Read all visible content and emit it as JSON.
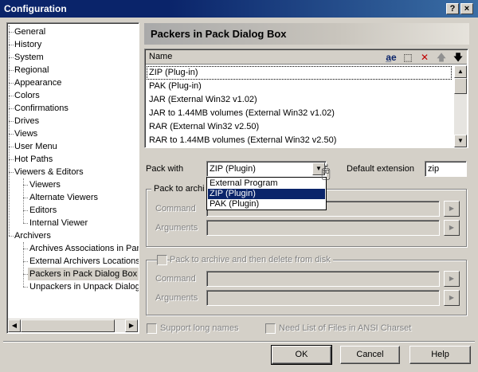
{
  "window": {
    "title": "Configuration",
    "help_glyph": "?",
    "close_glyph": "×"
  },
  "tree": {
    "items": [
      {
        "label": "General",
        "level": 0
      },
      {
        "label": "History",
        "level": 0
      },
      {
        "label": "System",
        "level": 0
      },
      {
        "label": "Regional",
        "level": 0
      },
      {
        "label": "Appearance",
        "level": 0
      },
      {
        "label": "Colors",
        "level": 0
      },
      {
        "label": "Confirmations",
        "level": 0
      },
      {
        "label": "Drives",
        "level": 0
      },
      {
        "label": "Views",
        "level": 0
      },
      {
        "label": "User Menu",
        "level": 0
      },
      {
        "label": "Hot Paths",
        "level": 0
      },
      {
        "label": "Viewers & Editors",
        "level": 0
      },
      {
        "label": "Viewers",
        "level": 1
      },
      {
        "label": "Alternate Viewers",
        "level": 1
      },
      {
        "label": "Editors",
        "level": 1
      },
      {
        "label": "Internal Viewer",
        "level": 1
      },
      {
        "label": "Archivers",
        "level": 0
      },
      {
        "label": "Archives Associations in Pan",
        "level": 1
      },
      {
        "label": "External Archivers Locations",
        "level": 1
      },
      {
        "label": "Packers in Pack Dialog Box",
        "level": 1
      },
      {
        "label": "Unpackers in Unpack Dialog",
        "level": 1
      }
    ],
    "selected": "Packers in Pack Dialog Box"
  },
  "page": {
    "title": "Packers in Pack Dialog Box"
  },
  "list": {
    "column_name": "Name",
    "rows": [
      "ZIP (Plug-in)",
      "PAK (Plug-in)",
      "JAR (External Win32 v1.02)",
      "JAR to 1.44MB volumes (External Win32 v1.02)",
      "RAR (External Win32 v2.50)",
      "RAR to 1.44MB volumes (External Win32 v2.50)"
    ],
    "selected_index": 0,
    "toolbar_icons": [
      "rename-icon",
      "new-item-icon",
      "delete-icon",
      "move-up-icon",
      "move-down-icon"
    ]
  },
  "pack_with": {
    "label": "Pack with",
    "value": "ZIP (Plugin)",
    "options": [
      "External Program",
      "ZIP (Plugin)",
      "PAK (Plugin)"
    ],
    "selected_option": "ZIP (Plugin)"
  },
  "default_extension": {
    "label": "Default extension",
    "value": "zip"
  },
  "group1": {
    "title_visible": "Pack to archi",
    "command_label": "Command",
    "arguments_label": "Arguments",
    "command_value": "",
    "arguments_value": ""
  },
  "group2": {
    "title": "Pack to archive and then delete from disk",
    "command_label": "Command",
    "arguments_label": "Arguments",
    "command_value": "",
    "arguments_value": ""
  },
  "options": {
    "support_long_names": "Support long names",
    "need_list_ansi": "Need List of Files in ANSI Charset"
  },
  "buttons": {
    "ok": "OK",
    "cancel": "Cancel",
    "help": "Help"
  },
  "colors": {
    "titlebar": "#0a246a",
    "selection": "#0a246a",
    "face": "#d4d0c8"
  }
}
